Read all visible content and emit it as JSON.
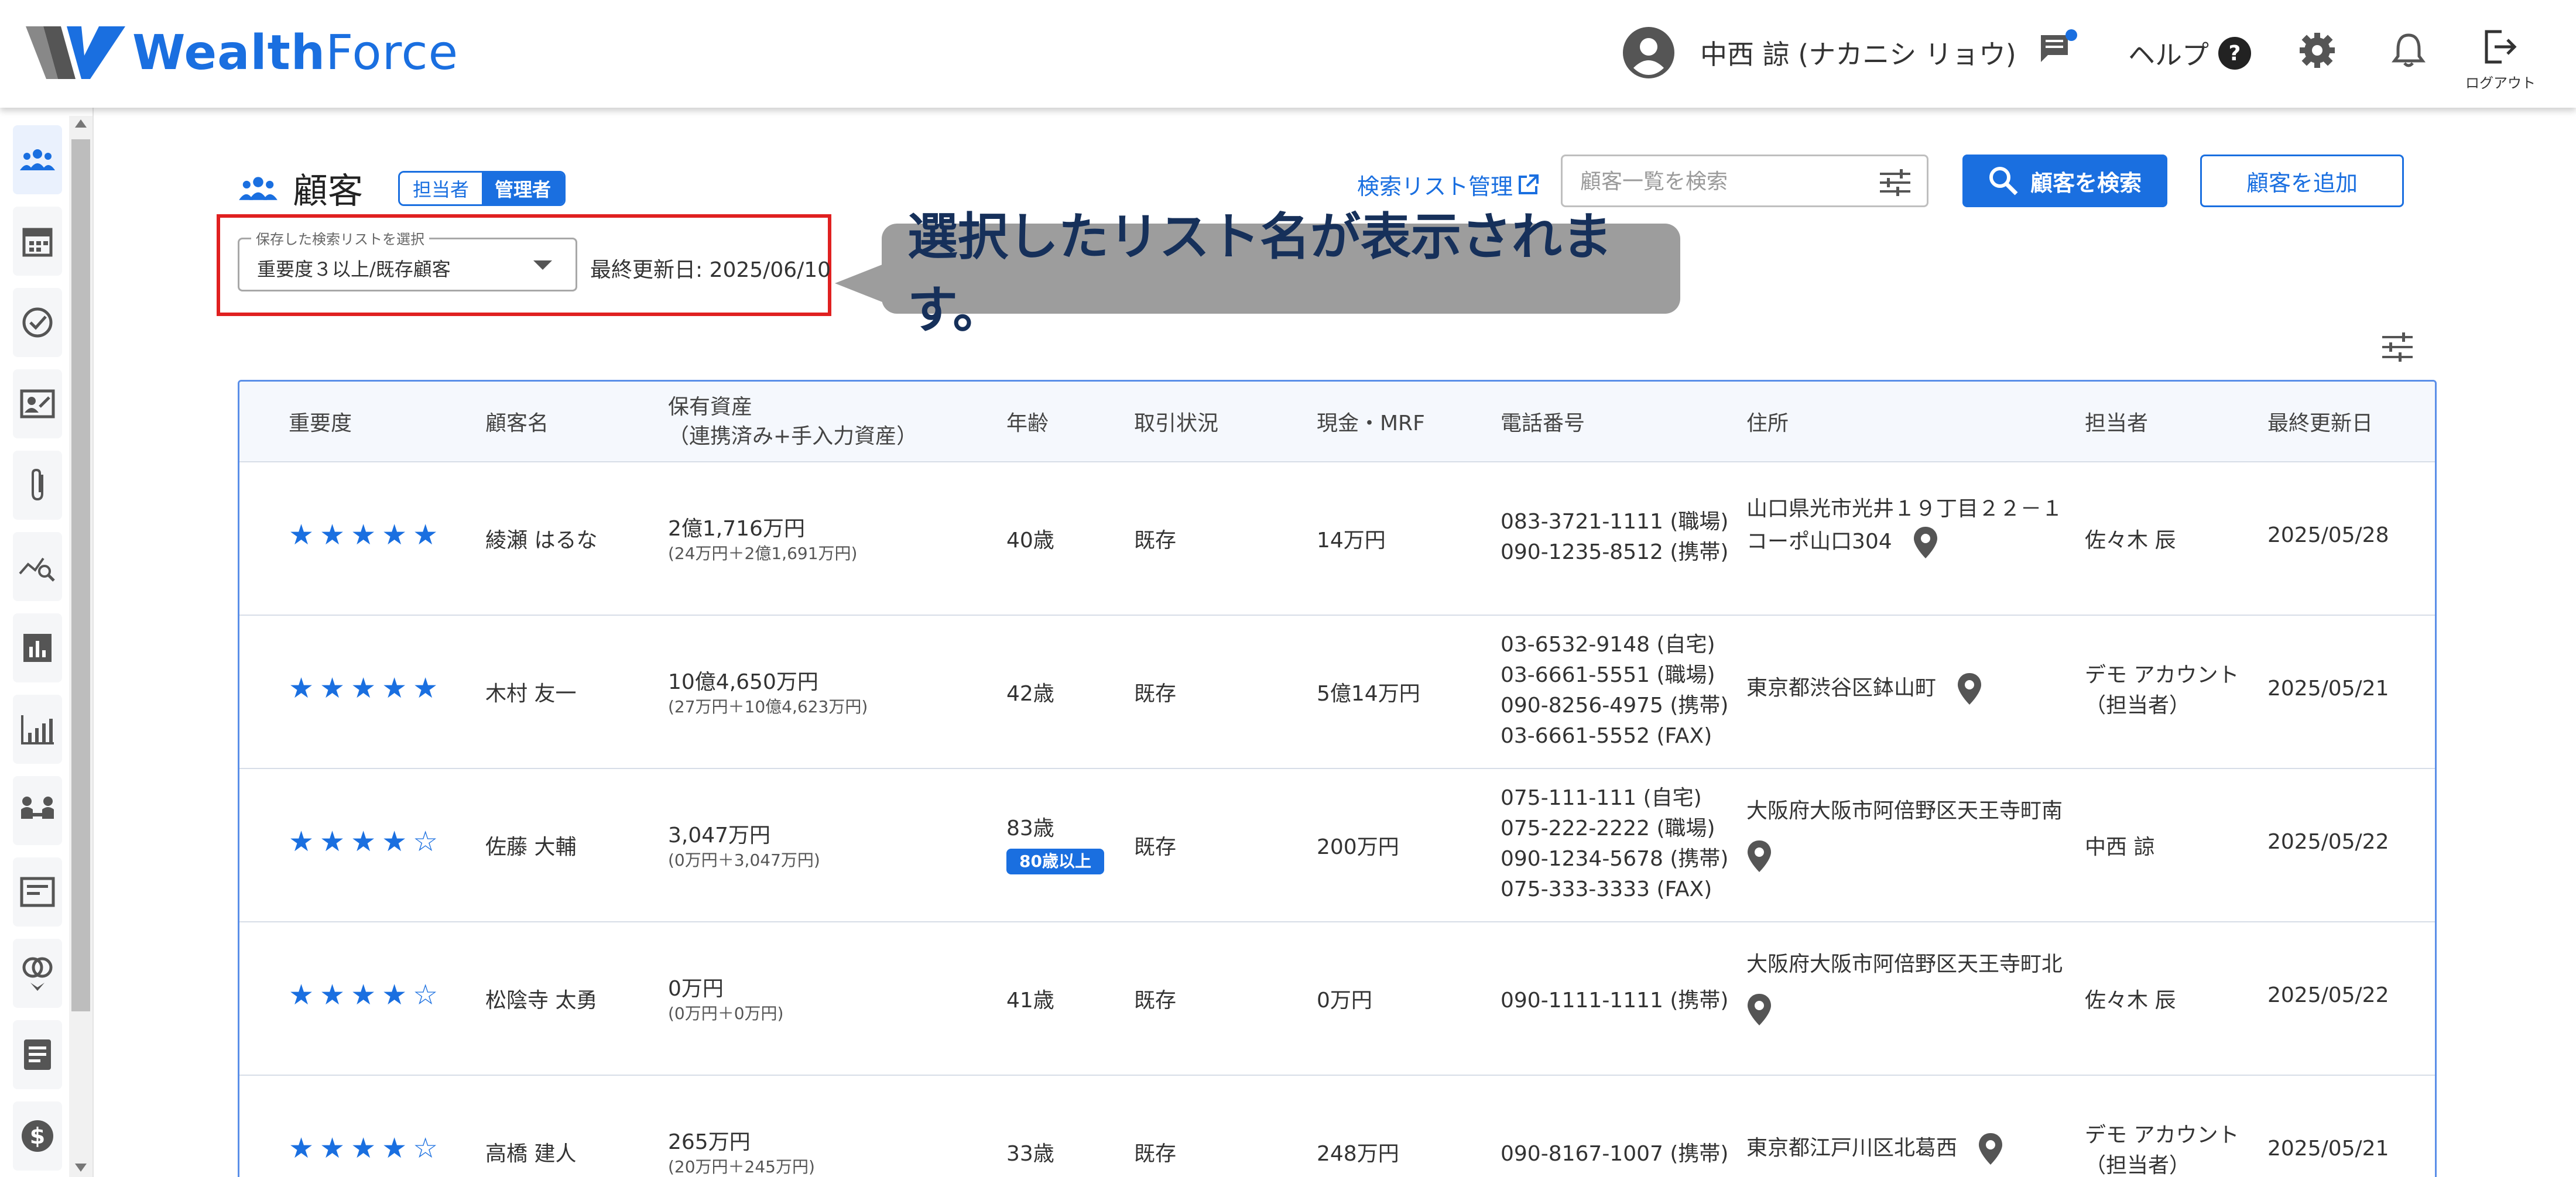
{
  "header": {
    "logo_text_bold": "Wealth",
    "logo_text_light": "Force",
    "user_name": "中西 諒 (ナカニシ リョウ)",
    "help_label": "ヘルプ",
    "logout_label": "ログアウト"
  },
  "sidebar": {
    "items": [
      "customers",
      "calendar",
      "tasks",
      "profile-card",
      "attachments",
      "analysis",
      "reports",
      "charts",
      "meeting",
      "forms",
      "matching",
      "documents",
      "finance"
    ]
  },
  "page": {
    "title": "顧客",
    "role_tabs": [
      "担当者",
      "管理者"
    ],
    "active_role": "管理者",
    "search_list_link": "検索リスト管理",
    "search_placeholder": "顧客一覧を検索",
    "search_button": "顧客を検索",
    "add_button": "顧客を追加",
    "saved_list_label": "保存した検索リストを選択",
    "saved_list_value": "重要度３以上/既存顧客",
    "last_updated": "最終更新日: 2025/06/10",
    "callout": "選択したリスト名が表示されます。"
  },
  "table": {
    "headers": {
      "importance": "重要度",
      "name": "顧客名",
      "assets": "保有資産",
      "assets_sub": "（連携済み+手入力資産）",
      "age": "年齢",
      "status": "取引状況",
      "cash": "現金・MRF",
      "phone": "電話番号",
      "address": "住所",
      "staff": "担当者",
      "updated": "最終更新日"
    },
    "rows": [
      {
        "stars": "★★★★★",
        "name": "綾瀬 はるな",
        "assets": "2億1,716万円",
        "assets_detail": "(24万円＋2億1,691万円)",
        "age": "40歳",
        "badge": "",
        "status": "既存",
        "cash": "14万円",
        "phones": [
          "083-3721-1111 (職場)",
          "090-1235-8512 (携帯)"
        ],
        "address_line1": "山口県光市光井１９丁目２２－１",
        "address_line2": "コーポ山口304",
        "staff_line1": "佐々木 辰",
        "staff_line2": "",
        "updated": "2025/05/28"
      },
      {
        "stars": "★★★★★",
        "name": "木村 友一",
        "assets": "10億4,650万円",
        "assets_detail": "(27万円＋10億4,623万円)",
        "age": "42歳",
        "badge": "",
        "status": "既存",
        "cash": "5億14万円",
        "phones": [
          "03-6532-9148 (自宅)",
          "03-6661-5551 (職場)",
          "090-8256-4975 (携帯)",
          "03-6661-5552 (FAX)"
        ],
        "address_line1": "東京都渋谷区鉢山町",
        "address_line2": "",
        "staff_line1": "デモ アカウント",
        "staff_line2": "（担当者）",
        "updated": "2025/05/21"
      },
      {
        "stars": "★★★★☆",
        "name": "佐藤 大輔",
        "assets": "3,047万円",
        "assets_detail": "(0万円＋3,047万円)",
        "age": "83歳",
        "badge": "80歳以上",
        "status": "既存",
        "cash": "200万円",
        "phones": [
          "075-111-111 (自宅)",
          "075-222-2222 (職場)",
          "090-1234-5678 (携帯)",
          "075-333-3333 (FAX)"
        ],
        "address_line1": "大阪府大阪市阿倍野区天王寺町南",
        "address_line2": "",
        "staff_line1": "中西 諒",
        "staff_line2": "",
        "updated": "2025/05/22"
      },
      {
        "stars": "★★★★☆",
        "name": "松陰寺 太勇",
        "assets": "0万円",
        "assets_detail": "(0万円＋0万円)",
        "age": "41歳",
        "badge": "",
        "status": "既存",
        "cash": "0万円",
        "phones": [
          "090-1111-1111 (携帯)"
        ],
        "address_line1": "大阪府大阪市阿倍野区天王寺町北",
        "address_line2": "",
        "staff_line1": "佐々木 辰",
        "staff_line2": "",
        "updated": "2025/05/22"
      },
      {
        "stars": "★★★★☆",
        "name": "高橋 建人",
        "assets": "265万円",
        "assets_detail": "(20万円＋245万円)",
        "age": "33歳",
        "badge": "",
        "status": "既存",
        "cash": "248万円",
        "phones": [
          "090-8167-1007 (携帯)"
        ],
        "address_line1": "東京都江戸川区北葛西",
        "address_line2": "",
        "staff_line1": "デモ アカウント",
        "staff_line2": "（担当者）",
        "updated": "2025/05/21"
      }
    ]
  },
  "colors": {
    "brand_blue": "#1a6fe0",
    "highlight_red": "#e02020",
    "callout_gray": "#9d9d9d",
    "callout_text": "#16305a"
  }
}
